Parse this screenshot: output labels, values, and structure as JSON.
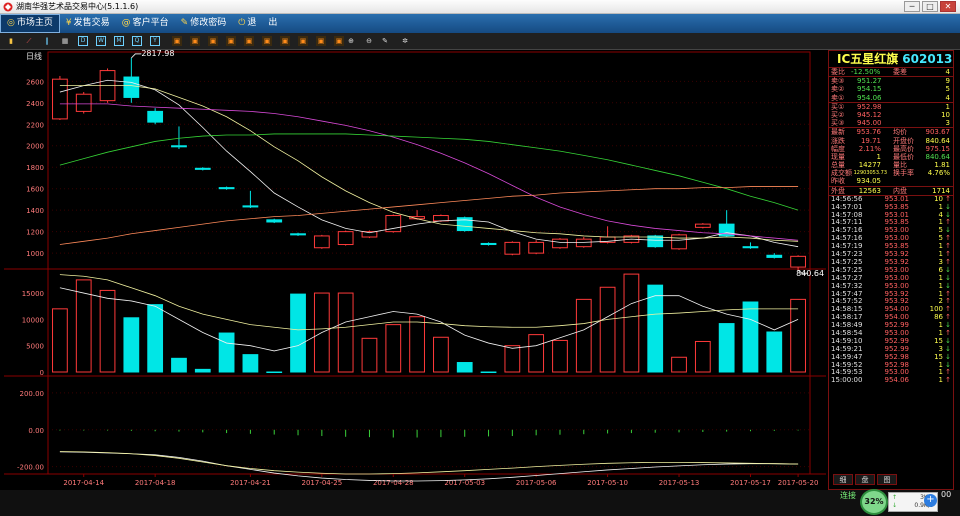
{
  "window": {
    "title": "湖南华强艺术品交易中心(5.1.1.6)",
    "controls": [
      "─",
      "□",
      "✕"
    ]
  },
  "menu": {
    "items": [
      {
        "label": "市场主页",
        "icon": "home-icon",
        "glyph": "◎",
        "active": true
      },
      {
        "label": "发售交易",
        "icon": "yen-icon",
        "glyph": "¥",
        "active": false
      },
      {
        "label": "客户平台",
        "icon": "globe-icon",
        "glyph": "@",
        "active": false
      },
      {
        "label": "修改密码",
        "icon": "lock-icon",
        "glyph": "✎",
        "active": false
      },
      {
        "label": "退",
        "icon": "power-icon",
        "glyph": "⏻",
        "active": false
      },
      {
        "label": "出",
        "icon": "",
        "glyph": "",
        "active": false
      }
    ]
  },
  "toolbar": {
    "buttons": [
      {
        "name": "bar-chart-icon",
        "glyph": "▮",
        "color": "#f6c343"
      },
      {
        "name": "line-chart-icon",
        "glyph": "⟋",
        "color": "#ff5a5a"
      },
      {
        "name": "candle-icon",
        "glyph": "‖",
        "color": "#6ed1ff"
      },
      {
        "name": "grid-icon",
        "glyph": "▦",
        "color": "#cccccc"
      },
      {
        "name": "day-period-icon",
        "glyph": "D",
        "color": "#6ed1ff"
      },
      {
        "name": "week-period-icon",
        "glyph": "W",
        "color": "#6ed1ff"
      },
      {
        "name": "month-period-icon",
        "glyph": "M",
        "color": "#6ed1ff"
      },
      {
        "name": "quarter-period-icon",
        "glyph": "Q",
        "color": "#6ed1ff"
      },
      {
        "name": "year-period-icon",
        "glyph": "Y",
        "color": "#6ed1ff"
      },
      {
        "name": "indicator-1-icon",
        "glyph": "▣",
        "color": "#ff8c1a"
      },
      {
        "name": "indicator-2-icon",
        "glyph": "▣",
        "color": "#ff8c1a"
      },
      {
        "name": "indicator-3-icon",
        "glyph": "▣",
        "color": "#ff8c1a"
      },
      {
        "name": "indicator-4-icon",
        "glyph": "▣",
        "color": "#ff8c1a"
      },
      {
        "name": "indicator-5-icon",
        "glyph": "▣",
        "color": "#ff8c1a"
      },
      {
        "name": "indicator-6-icon",
        "glyph": "▣",
        "color": "#ff8c1a"
      },
      {
        "name": "indicator-7-icon",
        "glyph": "▣",
        "color": "#ff8c1a"
      },
      {
        "name": "indicator-8-icon",
        "glyph": "▣",
        "color": "#ff8c1a"
      },
      {
        "name": "indicator-9-icon",
        "glyph": "▣",
        "color": "#ff8c1a"
      },
      {
        "name": "indicator-10-icon",
        "glyph": "▣",
        "color": "#ff8c1a"
      },
      {
        "name": "zoom-in-icon",
        "glyph": "⊕",
        "color": "#dddddd"
      },
      {
        "name": "zoom-out-icon",
        "glyph": "⊖",
        "color": "#dddddd"
      },
      {
        "name": "draw-icon",
        "glyph": "✎",
        "color": "#dddddd"
      },
      {
        "name": "settings-gear-icon",
        "glyph": "✲",
        "color": "#dddddd"
      }
    ]
  },
  "chart_data": {
    "type": "candlestick",
    "period_label": "日线",
    "price_axis": {
      "ticks": [
        2600,
        2400,
        2200,
        2000,
        1800,
        1600,
        1400,
        1200,
        1000
      ],
      "ylim": [
        880,
        2780
      ]
    },
    "volume_axis": {
      "ticks": [
        15000,
        10000,
        5000,
        0
      ],
      "ylim": [
        0,
        19000
      ]
    },
    "macd_axis": {
      "ticks": [
        "200.00",
        "0.00",
        "-200.00"
      ],
      "ylim": [
        -240,
        270
      ]
    },
    "x_labels": [
      "2017-04-14",
      "2017-04-18",
      "2017-04-21",
      "2017-04-25",
      "2017-04-28",
      "2017-05-03",
      "2017-05-06",
      "2017-05-10",
      "2017-05-13",
      "2017-05-17",
      "2017-05-20"
    ],
    "annotations": {
      "high": "2817.98",
      "low": "840.64"
    },
    "candles": [
      {
        "o": 2250,
        "c": 2620,
        "h": 2650,
        "l": 2240,
        "v": 12000
      },
      {
        "o": 2320,
        "c": 2480,
        "h": 2500,
        "l": 2300,
        "v": 17500
      },
      {
        "o": 2420,
        "c": 2700,
        "h": 2720,
        "l": 2400,
        "v": 15500
      },
      {
        "o": 2640,
        "c": 2450,
        "h": 2818,
        "l": 2400,
        "v": 10300
      },
      {
        "o": 2320,
        "c": 2220,
        "h": 2350,
        "l": 2200,
        "v": 12800
      },
      {
        "o": 2000,
        "c": 1990,
        "h": 2180,
        "l": 1970,
        "v": 2600
      },
      {
        "o": 1790,
        "c": 1780,
        "h": 1800,
        "l": 1770,
        "v": 500
      },
      {
        "o": 1610,
        "c": 1600,
        "h": 1620,
        "l": 1590,
        "v": 7400
      },
      {
        "o": 1440,
        "c": 1430,
        "h": 1580,
        "l": 1420,
        "v": 3300
      },
      {
        "o": 1310,
        "c": 1290,
        "h": 1320,
        "l": 1280,
        "v": 0
      },
      {
        "o": 1180,
        "c": 1170,
        "h": 1190,
        "l": 1160,
        "v": 14800
      },
      {
        "o": 1050,
        "c": 1160,
        "h": 1170,
        "l": 1040,
        "v": 15000
      },
      {
        "o": 1080,
        "c": 1200,
        "h": 1210,
        "l": 1070,
        "v": 15000
      },
      {
        "o": 1150,
        "c": 1200,
        "h": 1210,
        "l": 1140,
        "v": 6400
      },
      {
        "o": 1200,
        "c": 1350,
        "h": 1360,
        "l": 1190,
        "v": 9000
      },
      {
        "o": 1320,
        "c": 1340,
        "h": 1400,
        "l": 1310,
        "v": 10500
      },
      {
        "o": 1300,
        "c": 1350,
        "h": 1360,
        "l": 1290,
        "v": 6600
      },
      {
        "o": 1330,
        "c": 1210,
        "h": 1340,
        "l": 1200,
        "v": 1800
      },
      {
        "o": 1090,
        "c": 1080,
        "h": 1100,
        "l": 1070,
        "v": 0
      },
      {
        "o": 990,
        "c": 1100,
        "h": 1110,
        "l": 980,
        "v": 5000
      },
      {
        "o": 1000,
        "c": 1100,
        "h": 1120,
        "l": 990,
        "v": 7100
      },
      {
        "o": 1050,
        "c": 1130,
        "h": 1140,
        "l": 1040,
        "v": 6000
      },
      {
        "o": 1060,
        "c": 1130,
        "h": 1150,
        "l": 1050,
        "v": 13800
      },
      {
        "o": 1100,
        "c": 1150,
        "h": 1250,
        "l": 1090,
        "v": 16100
      },
      {
        "o": 1100,
        "c": 1160,
        "h": 1170,
        "l": 1090,
        "v": 18600
      },
      {
        "o": 1160,
        "c": 1060,
        "h": 1170,
        "l": 1050,
        "v": 16500
      },
      {
        "o": 1040,
        "c": 1170,
        "h": 1180,
        "l": 1030,
        "v": 2800
      },
      {
        "o": 1240,
        "c": 1270,
        "h": 1280,
        "l": 1230,
        "v": 5800
      },
      {
        "o": 1270,
        "c": 1160,
        "h": 1400,
        "l": 1150,
        "v": 9200
      },
      {
        "o": 1060,
        "c": 1050,
        "h": 1100,
        "l": 1040,
        "v": 13300
      },
      {
        "o": 980,
        "c": 960,
        "h": 1000,
        "l": 950,
        "v": 7600
      },
      {
        "o": 870,
        "c": 970,
        "h": 980,
        "l": 840.64,
        "v": 13800
      }
    ],
    "ma_lines": [
      {
        "name": "MA5",
        "color": "#f2f2f2",
        "values": [
          2500,
          2560,
          2610,
          2590,
          2520,
          2380,
          2170,
          1950,
          1760,
          1560,
          1430,
          1310,
          1230,
          1190,
          1230,
          1270,
          1300,
          1310,
          1290,
          1200,
          1130,
          1100,
          1100,
          1110,
          1130,
          1120,
          1120,
          1140,
          1190,
          1160,
          1100,
          1060
        ]
      },
      {
        "name": "MA10",
        "color": "#f2f2a0",
        "values": [
          2560,
          2560,
          2560,
          2560,
          2530,
          2450,
          2370,
          2270,
          2140,
          1990,
          1860,
          1710,
          1580,
          1470,
          1380,
          1320,
          1270,
          1250,
          1230,
          1210,
          1190,
          1180,
          1160,
          1150,
          1150,
          1150,
          1140,
          1140,
          1150,
          1140,
          1120,
          1110
        ]
      },
      {
        "name": "MA20",
        "color": "#d84ad8",
        "values": [
          2390,
          2390,
          2390,
          2370,
          2360,
          2350,
          2340,
          2330,
          2320,
          2300,
          2270,
          2230,
          2190,
          2140,
          2080,
          2010,
          1930,
          1840,
          1740,
          1630,
          1520,
          1430,
          1360,
          1300,
          1260,
          1230,
          1210,
          1190,
          1180,
          1160,
          1140,
          1120
        ]
      },
      {
        "name": "MA30",
        "color": "#36d436",
        "values": [
          1820,
          1880,
          1940,
          1990,
          2040,
          2070,
          2090,
          2100,
          2100,
          2110,
          2110,
          2110,
          2110,
          2100,
          2090,
          2080,
          2070,
          2060,
          2040,
          2010,
          1980,
          1950,
          1910,
          1870,
          1820,
          1770,
          1720,
          1660,
          1600,
          1530,
          1470,
          1400
        ]
      },
      {
        "name": "MA60",
        "color": "#ff8a5a",
        "values": [
          1080,
          1110,
          1140,
          1180,
          1210,
          1240,
          1270,
          1300,
          1320,
          1340,
          1350,
          1370,
          1390,
          1410,
          1430,
          1450,
          1470,
          1490,
          1510,
          1530,
          1540,
          1560,
          1570,
          1580,
          1590,
          1600,
          1600,
          1610,
          1610,
          1620,
          1620,
          1620
        ]
      }
    ],
    "vol_lines": [
      {
        "name": "VMA5",
        "color": "#f2f2f2",
        "values": [
          16000,
          15000,
          14000,
          13500,
          12500,
          10000,
          7500,
          5500,
          5000,
          4000,
          5000,
          7500,
          9500,
          10500,
          11500,
          11000,
          9500,
          7000,
          5500,
          4500,
          5000,
          6500,
          8000,
          10500,
          13000,
          14500,
          14500,
          12500,
          11000,
          10000,
          8000,
          10000
        ]
      },
      {
        "name": "VMA10",
        "color": "#f2f2a0",
        "values": [
          18500,
          18200,
          17500,
          16000,
          14500,
          12500,
          11000,
          10000,
          9000,
          8500,
          8000,
          8200,
          8500,
          9000,
          9500,
          9500,
          9200,
          8800,
          8600,
          8500,
          8500,
          8800,
          9200,
          10000,
          10500,
          11000,
          11200,
          11500,
          11800,
          12000,
          12000,
          12000
        ]
      }
    ],
    "macd_dif": [
      -120,
      -122,
      -126,
      -130,
      -136,
      -150,
      -170,
      -195,
      -215,
      -235,
      -250,
      -262,
      -270,
      -275,
      -278,
      -278,
      -276,
      -272,
      -266,
      -258,
      -248,
      -238,
      -228,
      -218,
      -210,
      -202,
      -196,
      -190,
      -186,
      -184,
      -184,
      -186
    ],
    "macd_dea": [
      -118,
      -120,
      -124,
      -130,
      -140,
      -155,
      -175,
      -195,
      -210,
      -222,
      -230,
      -236,
      -240,
      -240,
      -238,
      -234,
      -228,
      -222,
      -215,
      -208,
      -200,
      -193,
      -187,
      -182,
      -179,
      -177,
      -177,
      -178,
      -180,
      -182,
      -184,
      -186
    ],
    "macd_hist": [
      -4,
      -4,
      -4,
      -6,
      -8,
      -10,
      -14,
      -18,
      -22,
      -26,
      -30,
      -34,
      -38,
      -40,
      -42,
      -42,
      -40,
      -38,
      -36,
      -34,
      -30,
      -27,
      -24,
      -20,
      -18,
      -16,
      -14,
      -12,
      -10,
      -8,
      -6,
      -4
    ]
  },
  "quote": {
    "name": "IC五星红旗",
    "code": "602013",
    "weibi": {
      "l1": "委比",
      "v1": "-12.50%",
      "l2": "委差",
      "v2": "4"
    },
    "asks": [
      {
        "label": "卖③",
        "price": "951.27",
        "vol": "9"
      },
      {
        "label": "卖②",
        "price": "954.15",
        "vol": "5"
      },
      {
        "label": "卖①",
        "price": "954.06",
        "vol": "4"
      }
    ],
    "bids": [
      {
        "label": "买①",
        "price": "952.98",
        "vol": "1"
      },
      {
        "label": "买②",
        "price": "945.12",
        "vol": "10"
      },
      {
        "label": "买③",
        "price": "945.00",
        "vol": "3"
      }
    ],
    "stats": [
      {
        "l1": "最新",
        "v1": "953.76",
        "l2": "均价",
        "v2": "903.67"
      },
      {
        "l1": "涨跌",
        "v1": "19.71",
        "l2": "开盘价",
        "v2": "840.64"
      },
      {
        "l1": "幅度",
        "v1": "2.11%",
        "l2": "最高价",
        "v2": "975.15"
      },
      {
        "l1": "现量",
        "v1": "1",
        "l2": "最低价",
        "v2": "840.64"
      },
      {
        "l1": "总量",
        "v1": "14277",
        "l2": "量比",
        "v2": "1.81"
      },
      {
        "l1": "成交额",
        "v1": "12903053.73",
        "l2": "换手率",
        "v2": "4.76%"
      },
      {
        "l1": "昨收",
        "v1": "934.05",
        "l2": "",
        "v2": ""
      }
    ],
    "inout": {
      "l1": "外盘",
      "v1": "12563",
      "l2": "内盘",
      "v2": "1714"
    }
  },
  "ticks": [
    {
      "t": "14:56:56",
      "p": "953.01",
      "v": "10",
      "d": "up"
    },
    {
      "t": "14:57:01",
      "p": "953.85",
      "v": "1",
      "d": "dn"
    },
    {
      "t": "14:57:08",
      "p": "953.01",
      "v": "4",
      "d": "dn"
    },
    {
      "t": "14:57:11",
      "p": "953.85",
      "v": "1",
      "d": "up"
    },
    {
      "t": "14:57:16",
      "p": "953.00",
      "v": "5",
      "d": "dn"
    },
    {
      "t": "14:57:16",
      "p": "953.00",
      "v": "5",
      "d": "up"
    },
    {
      "t": "14:57:19",
      "p": "953.85",
      "v": "1",
      "d": "up"
    },
    {
      "t": "14:57:23",
      "p": "953.92",
      "v": "1",
      "d": "up"
    },
    {
      "t": "14:57:25",
      "p": "953.92",
      "v": "3",
      "d": "up"
    },
    {
      "t": "14:57:25",
      "p": "953.00",
      "v": "6",
      "d": "dn"
    },
    {
      "t": "14:57:27",
      "p": "953.00",
      "v": "1",
      "d": "dn"
    },
    {
      "t": "14:57:32",
      "p": "953.00",
      "v": "1",
      "d": "dn"
    },
    {
      "t": "14:57:47",
      "p": "953.92",
      "v": "1",
      "d": "up"
    },
    {
      "t": "14:57:52",
      "p": "953.92",
      "v": "2",
      "d": "up"
    },
    {
      "t": "14:58:15",
      "p": "954.00",
      "v": "100",
      "d": "up"
    },
    {
      "t": "14:58:17",
      "p": "954.00",
      "v": "86",
      "d": "up"
    },
    {
      "t": "14:58:49",
      "p": "952.99",
      "v": "1",
      "d": "dn"
    },
    {
      "t": "14:58:54",
      "p": "953.00",
      "v": "1",
      "d": "up"
    },
    {
      "t": "14:59:10",
      "p": "952.99",
      "v": "15",
      "d": "dn"
    },
    {
      "t": "14:59:21",
      "p": "952.99",
      "v": "3",
      "d": "dn"
    },
    {
      "t": "14:59:47",
      "p": "952.98",
      "v": "15",
      "d": "dn"
    },
    {
      "t": "14:59:52",
      "p": "952.98",
      "v": "1",
      "d": "dn"
    },
    {
      "t": "14:59:53",
      "p": "953.00",
      "v": "1",
      "d": "up"
    },
    {
      "t": "15:00:00",
      "p": "954.06",
      "v": "1",
      "d": "up"
    }
  ],
  "tabs": [
    "细",
    "盘",
    "图"
  ],
  "status": {
    "label": "连接",
    "last_value": "00",
    "badge": "32%",
    "net_up": "3K/s",
    "net_down": "0.9K/s",
    "plus": "+"
  },
  "colors": {
    "up": "#ff3a3a",
    "down": "#00e6e6",
    "price_red": "#ff6060",
    "price_green": "#50e050",
    "label": "#ff7a7a",
    "axis": "#8a0000",
    "text": "#e0e0e0"
  }
}
